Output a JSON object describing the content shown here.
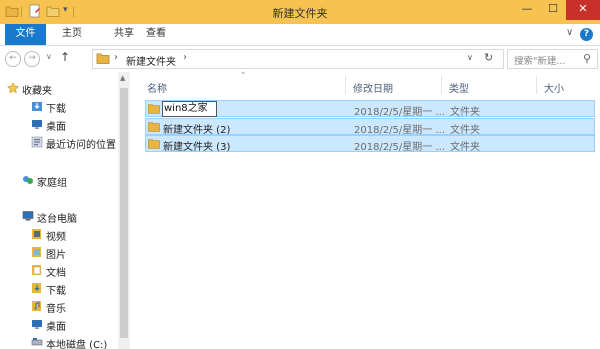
{
  "window": {
    "title": "新建文件夹",
    "minimize": "—",
    "maximize": "☐",
    "close": "✕"
  },
  "ribbon": {
    "tabs": [
      "文件",
      "主页",
      "共享",
      "查看"
    ],
    "collapse": "∨",
    "help": "?"
  },
  "nav": {
    "back": "←",
    "forward": "→",
    "history": "∨",
    "up": "↑",
    "breadcrumb_sep1": "›",
    "current_folder": "新建文件夹",
    "breadcrumb_sep2": "›",
    "dropdown": "∨",
    "refresh": "↻",
    "search_placeholder": "搜索\"新建...",
    "search_icon": "⚲"
  },
  "sidebar": {
    "favorites": "收藏夹",
    "favorites_items": [
      "下载",
      "桌面",
      "最近访问的位置"
    ],
    "homegroup": "家庭组",
    "this_pc": "这台电脑",
    "pc_items": [
      "视频",
      "图片",
      "文档",
      "下载",
      "音乐",
      "桌面",
      "本地磁盘 (C:)"
    ]
  },
  "columns": {
    "name": "名称",
    "modified": "修改日期",
    "type": "类型",
    "size": "大小",
    "sort_arrow": "˄"
  },
  "files": [
    {
      "name": "win8之家",
      "modified": "2018/2/5/星期一 ...",
      "type": "文件夹",
      "renaming": true
    },
    {
      "name": "新建文件夹 (2)",
      "modified": "2018/2/5/星期一 ...",
      "type": "文件夹",
      "renaming": false
    },
    {
      "name": "新建文件夹 (3)",
      "modified": "2018/2/5/星期一 ...",
      "type": "文件夹",
      "renaming": false
    }
  ],
  "colors": {
    "titlebar": "#f6c350",
    "file_tab": "#1979ca",
    "close_button": "#c7312a",
    "selection_fill": "#cce8ff",
    "selection_border": "#99d1ff"
  }
}
